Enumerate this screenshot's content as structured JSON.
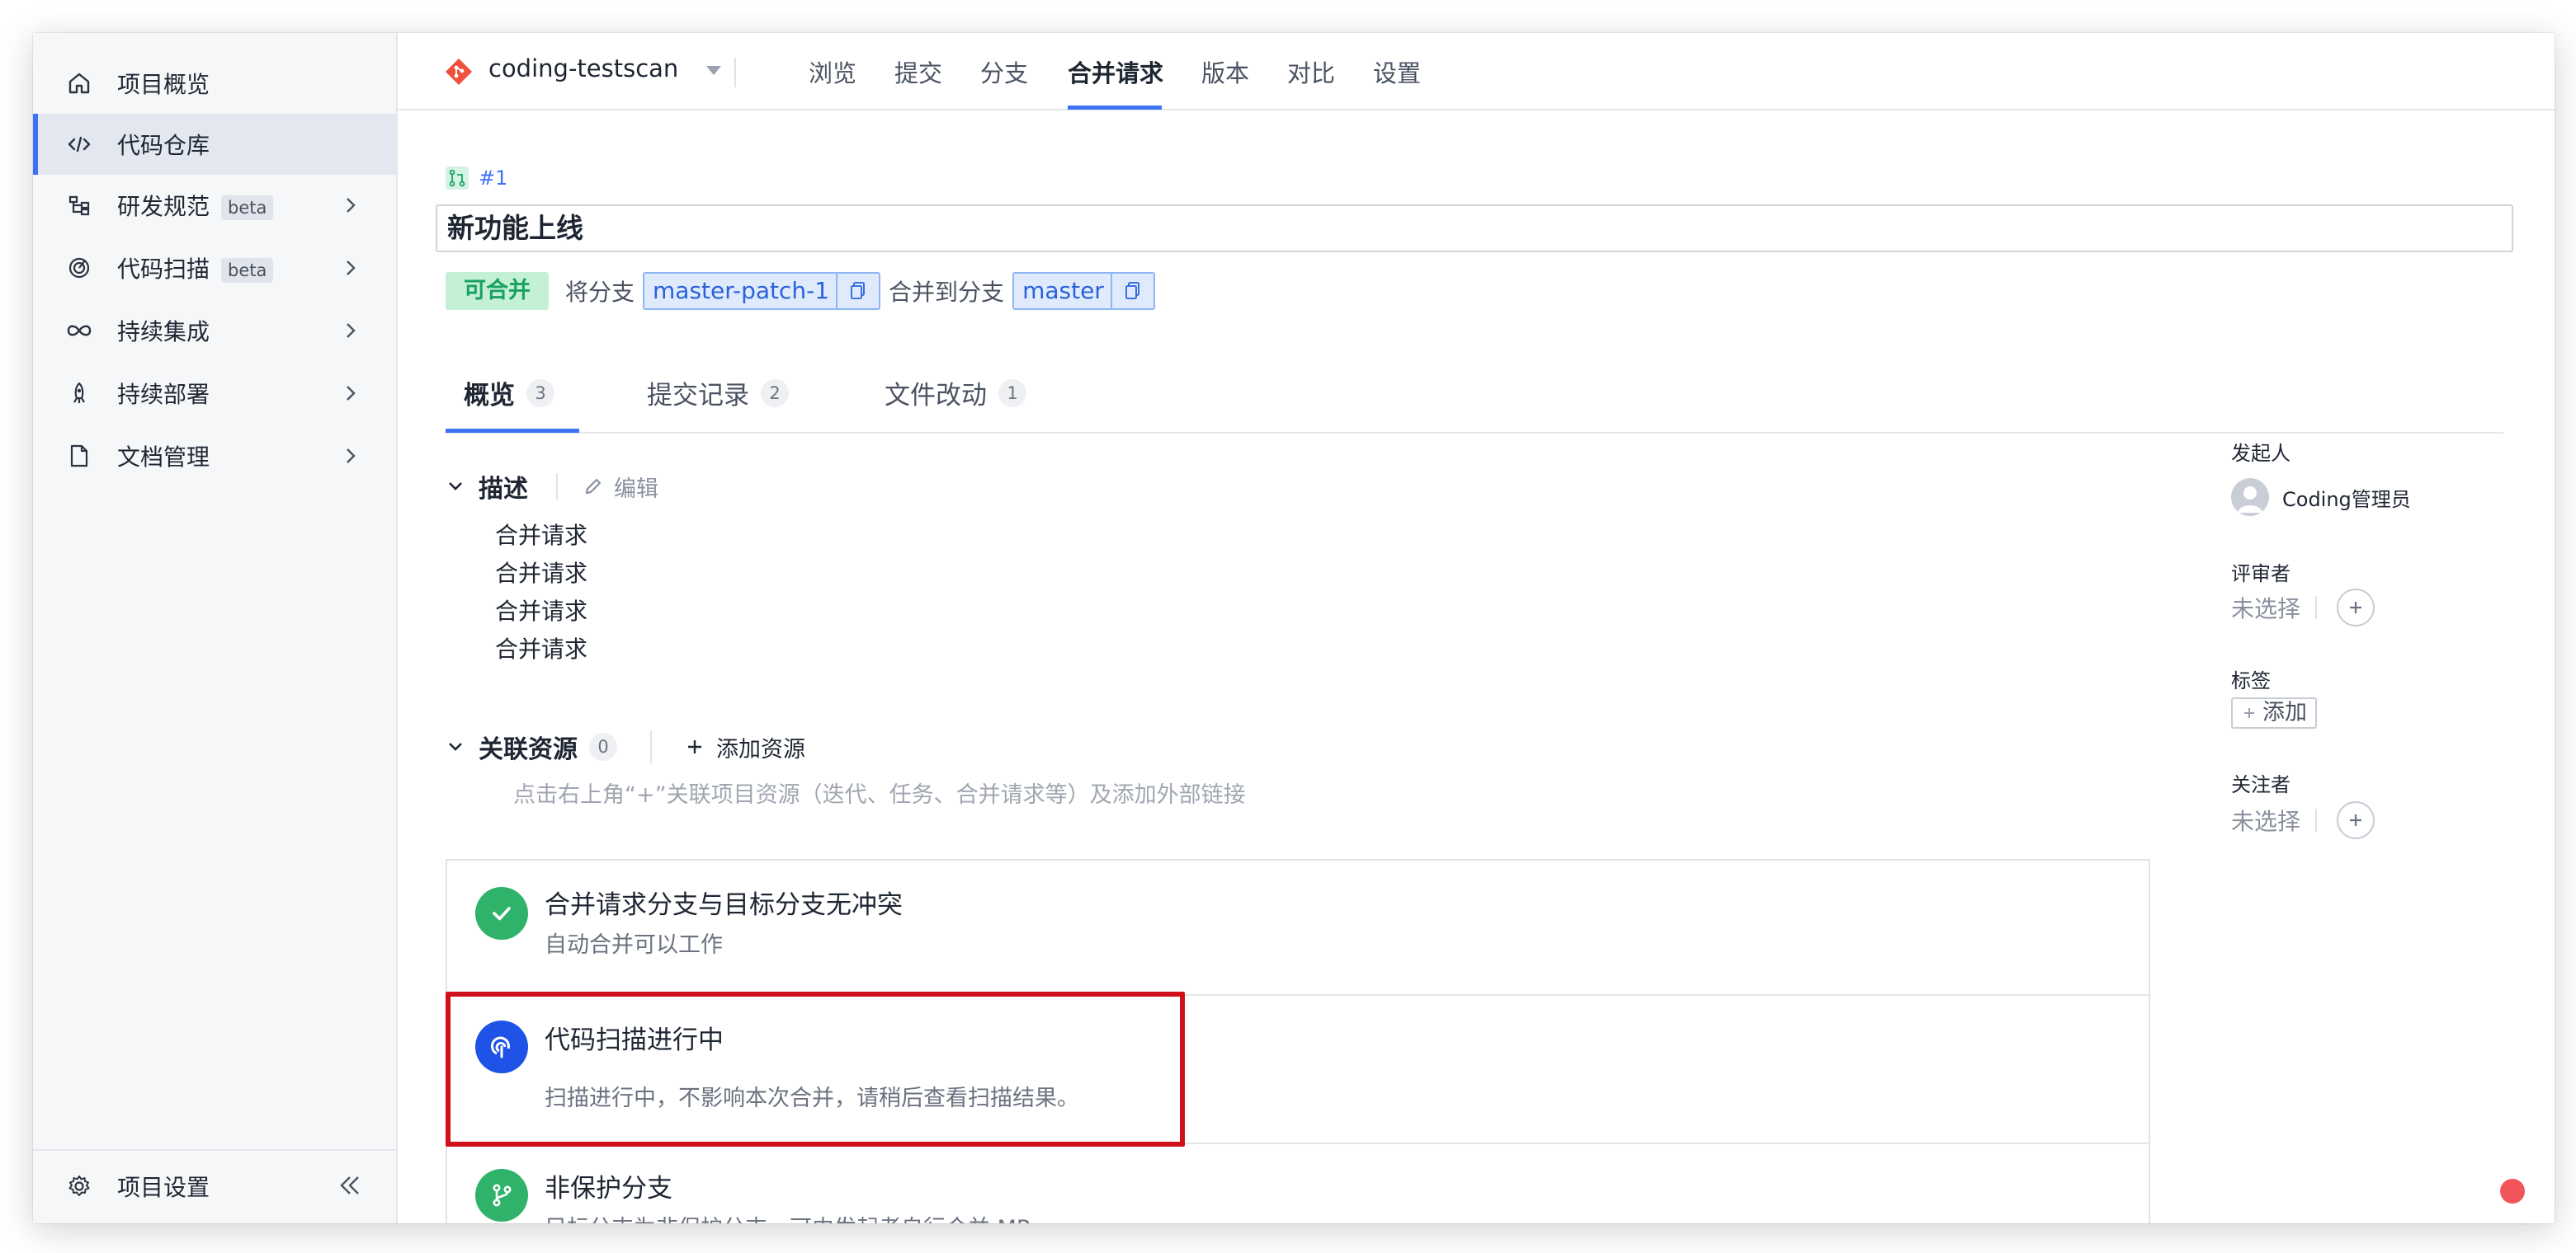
{
  "sidebar": {
    "items": [
      {
        "label": "项目概览",
        "icon": "home-icon"
      },
      {
        "label": "代码仓库",
        "icon": "code-icon"
      },
      {
        "label": "研发规范",
        "badge": "beta",
        "icon": "flow-icon"
      },
      {
        "label": "代码扫描",
        "badge": "beta",
        "icon": "scan-icon"
      },
      {
        "label": "持续集成",
        "icon": "infinity-icon"
      },
      {
        "label": "持续部署",
        "icon": "rocket-icon"
      },
      {
        "label": "文档管理",
        "icon": "document-icon"
      }
    ],
    "footer": {
      "label": "项目设置"
    }
  },
  "topbar": {
    "repo": "coding-testscan",
    "tabs": [
      "浏览",
      "提交",
      "分支",
      "合并请求",
      "版本",
      "对比",
      "设置"
    ],
    "active_tab": "合并请求"
  },
  "mr": {
    "id": "#1",
    "title": "新功能上线",
    "status": "可合并",
    "from_label": "将分支",
    "source_branch": "master-patch-1",
    "to_label": "合并到分支",
    "target_branch": "master"
  },
  "subtabs": [
    {
      "label": "概览",
      "count": "3"
    },
    {
      "label": "提交记录",
      "count": "2"
    },
    {
      "label": "文件改动",
      "count": "1"
    }
  ],
  "description": {
    "title": "描述",
    "edit": "编辑",
    "lines": [
      "合并请求",
      "合并请求",
      "合并请求",
      "合并请求"
    ]
  },
  "resources": {
    "title": "关联资源",
    "count": "0",
    "add": "添加资源",
    "hint": "点击右上角“+”关联项目资源（迭代、任务、合并请求等）及添加外部链接"
  },
  "checks": [
    {
      "title": "合并请求分支与目标分支无冲突",
      "subtitle": "自动合并可以工作",
      "color": "#2fb36a",
      "icon": "check-icon"
    },
    {
      "title": "代码扫描进行中",
      "subtitle": "扫描进行中，不影响本次合并，请稍后查看扫描结果。",
      "color": "#1f52e6",
      "icon": "scan-icon"
    },
    {
      "title": "非保护分支",
      "subtitle": "目标分支为非保护分支，可由发起者自行合并 MR",
      "color": "#2fb36a",
      "icon": "branch-icon"
    }
  ],
  "right": {
    "initiator_label": "发起人",
    "initiator_name": "Coding管理员",
    "reviewers_label": "评审者",
    "reviewers_value": "未选择",
    "tags_label": "标签",
    "tags_add": "添加",
    "watchers_label": "关注者",
    "watchers_value": "未选择"
  },
  "colors": {
    "accent": "#3d72f5",
    "success": "#2fb36a",
    "highlight": "#d0101b"
  }
}
